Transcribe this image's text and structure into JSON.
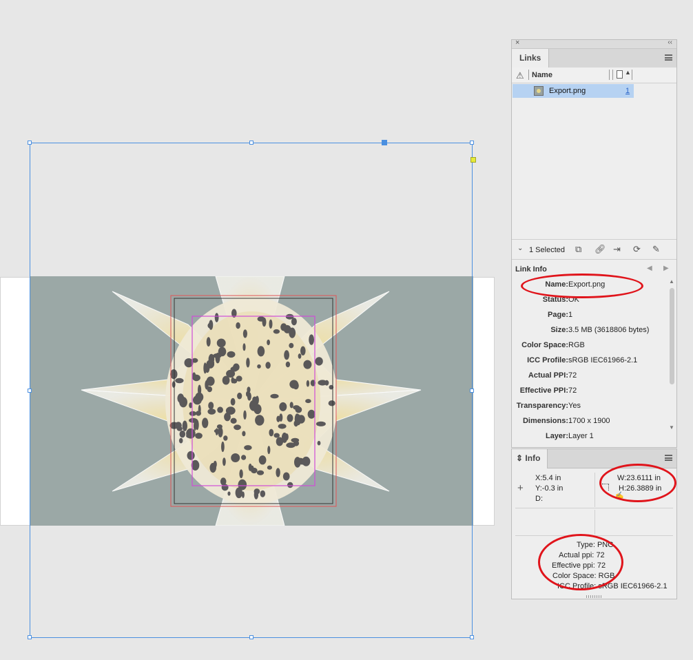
{
  "links_panel": {
    "tab": "Links",
    "column_name": "Name",
    "items": [
      {
        "name": "Export.png",
        "page": "1"
      }
    ],
    "selected_count": "1 Selected",
    "link_info_title": "Link Info",
    "link_info": [
      {
        "label": "Name:",
        "value": "Export.png"
      },
      {
        "label": "Status:",
        "value": "OK"
      },
      {
        "label": "Page:",
        "value": "1"
      },
      {
        "label": "Size:",
        "value": "3.5 MB (3618806 bytes)"
      },
      {
        "label": "Color Space:",
        "value": "RGB"
      },
      {
        "label": "ICC Profile:",
        "value": "sRGB IEC61966-2.1"
      },
      {
        "label": "Actual PPI:",
        "value": "72"
      },
      {
        "label": "Effective PPI:",
        "value": "72"
      },
      {
        "label": "Transparency:",
        "value": "Yes"
      },
      {
        "label": "Dimensions:",
        "value": "1700 x 1900"
      },
      {
        "label": "Layer:",
        "value": "Layer 1"
      }
    ]
  },
  "info_panel": {
    "tab": "Info",
    "x_label": "X:",
    "x_value": "5.4 in",
    "y_label": "Y:",
    "y_value": "-0.3 in",
    "d_label": "D:",
    "w_label": "W:",
    "w_value": "23.6111 in",
    "h_label": "H:",
    "h_value": "26.3889 in",
    "details": [
      {
        "label": "Type:",
        "value": "PNG"
      },
      {
        "label": "Actual ppi:",
        "value": "72"
      },
      {
        "label": "Effective ppi:",
        "value": "72"
      },
      {
        "label": "Color Space:",
        "value": "RGB"
      },
      {
        "label": "ICC Profile:",
        "value": "sRGB IEC61966-2.1"
      }
    ]
  },
  "colors": {
    "canvas_bg": "#e7e7e7",
    "artwork_bg": "#9ba8a6",
    "frame_blue": "#4a8fe0",
    "selection_row": "#b6d2f2",
    "annotation_red": "#e0141b",
    "guide_magenta": "#d04cd8"
  }
}
